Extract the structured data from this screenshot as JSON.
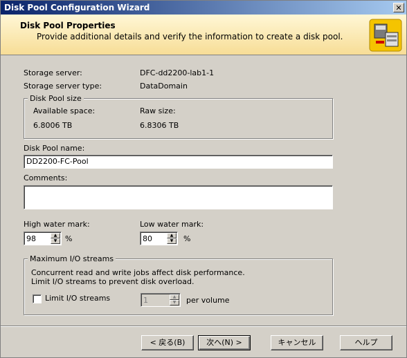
{
  "window": {
    "title": "Disk Pool Configuration Wizard",
    "close_glyph": "✕"
  },
  "header": {
    "title": "Disk Pool Properties",
    "subtitle": "Provide additional details and verify the information to create a disk pool.",
    "icon": "disk-pool-wizard-icon"
  },
  "server": {
    "storage_server_label": "Storage server:",
    "storage_server_value": "DFC-dd2200-lab1-1",
    "server_type_label": "Storage server type:",
    "server_type_value": "DataDomain"
  },
  "size_group": {
    "legend": "Disk Pool size",
    "available_label": "Available space:",
    "available_value": "6.8006 TB",
    "raw_label": "Raw size:",
    "raw_value": "6.8306 TB"
  },
  "pool_name": {
    "label": "Disk Pool name:",
    "value": "DD2200-FC-Pool"
  },
  "comments": {
    "label": "Comments:",
    "value": ""
  },
  "high_water": {
    "label": "High water mark:",
    "value": "98",
    "unit": "%"
  },
  "low_water": {
    "label": "Low water mark:",
    "value": "80",
    "unit": "%"
  },
  "io_group": {
    "legend": "Maximum I/O streams",
    "desc_line1": "Concurrent read and write jobs affect disk performance.",
    "desc_line2": "Limit I/O streams to prevent disk overload.",
    "checkbox_label": "Limit I/O streams",
    "checkbox_checked": false,
    "streams_value": "1",
    "per_volume": "per volume"
  },
  "buttons": {
    "back": "< 戻る(B)",
    "next": "次へ(N) >",
    "cancel": "キャンセル",
    "help": "ヘルプ"
  }
}
